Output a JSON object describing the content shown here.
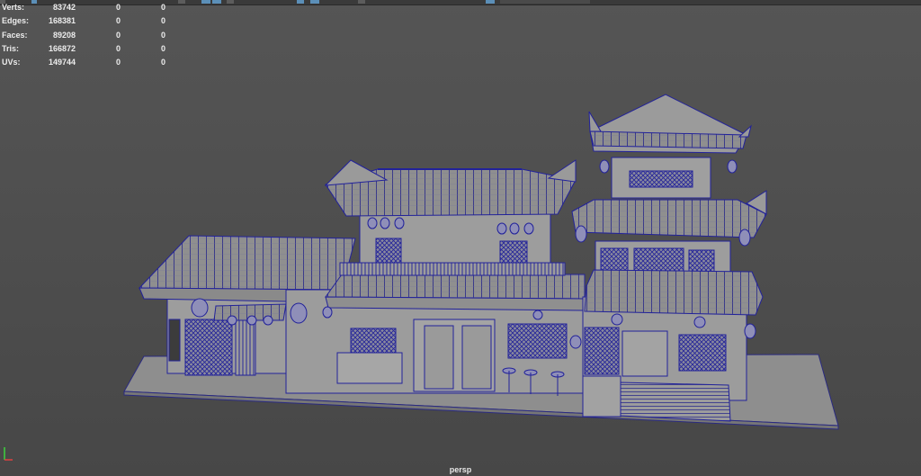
{
  "hud": {
    "rows": [
      {
        "label": "Verts:",
        "v1": "83742",
        "v2": "0",
        "v3": "0"
      },
      {
        "label": "Edges:",
        "v1": "168381",
        "v2": "0",
        "v3": "0"
      },
      {
        "label": "Faces:",
        "v1": "89208",
        "v2": "0",
        "v3": "0"
      },
      {
        "label": "Tris:",
        "v1": "166872",
        "v2": "0",
        "v3": "0"
      },
      {
        "label": "UVs:",
        "v1": "149744",
        "v2": "0",
        "v3": "0"
      }
    ]
  },
  "viewport": {
    "camera": "persp",
    "wireframe_color": "#1f1f9a",
    "shaded_color": "#9c9c9c",
    "background": "#505050"
  }
}
